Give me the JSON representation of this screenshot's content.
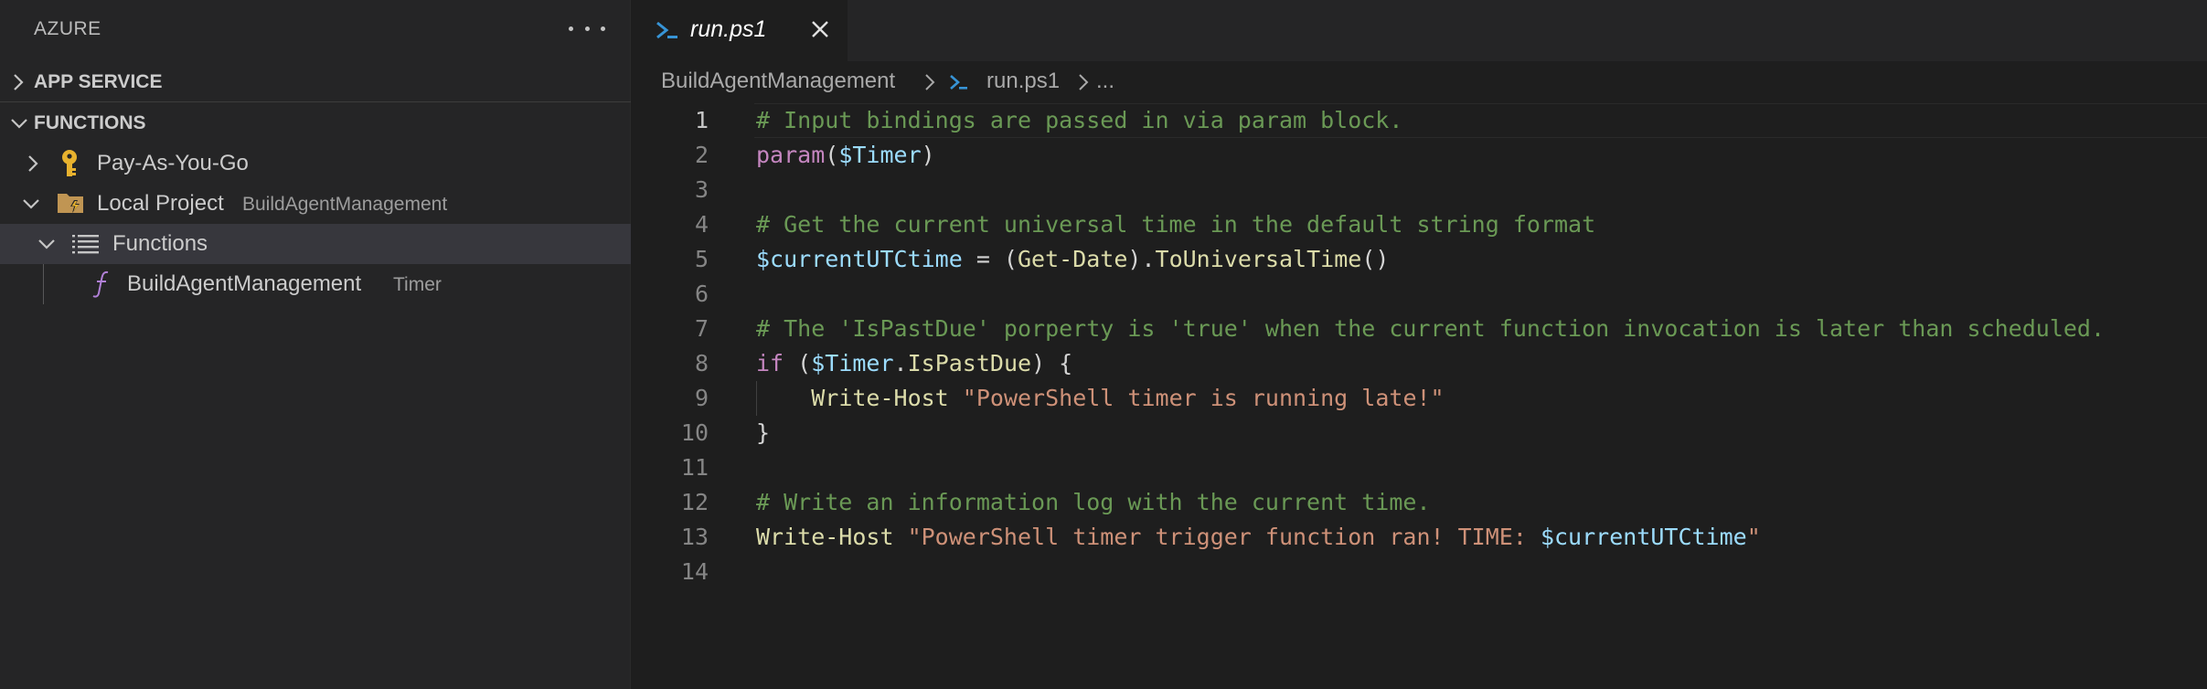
{
  "sidebar": {
    "title": "AZURE",
    "more_icon": "ellipsis-icon",
    "sections": {
      "app_service": "APP SERVICE",
      "functions": "FUNCTIONS"
    },
    "tree": {
      "subscription": "Pay-As-You-Go",
      "local_project": {
        "label": "Local Project",
        "description": "BuildAgentManagement"
      },
      "functions_node": "Functions",
      "function_item": {
        "label": "BuildAgentManagement",
        "description": "Timer"
      }
    }
  },
  "editor": {
    "tab": {
      "label": "run.ps1",
      "icon": "powershell-icon"
    },
    "breadcrumb": {
      "folder": "BuildAgentManagement",
      "file": "run.ps1",
      "more": "..."
    },
    "current_line": 1,
    "lines": [
      {
        "number": "1",
        "tokens": [
          {
            "t": "# Input bindings are passed in via param block.",
            "c": "cm"
          }
        ]
      },
      {
        "number": "2",
        "tokens": [
          {
            "t": "param",
            "c": "kw"
          },
          {
            "t": "(",
            "c": "pl"
          },
          {
            "t": "$Timer",
            "c": "var"
          },
          {
            "t": ")",
            "c": "pl"
          }
        ]
      },
      {
        "number": "3",
        "tokens": []
      },
      {
        "number": "4",
        "tokens": [
          {
            "t": "# Get the current universal time in the default string format",
            "c": "cm"
          }
        ]
      },
      {
        "number": "5",
        "tokens": [
          {
            "t": "$currentUTCtime",
            "c": "var"
          },
          {
            "t": " = (",
            "c": "pl"
          },
          {
            "t": "Get-Date",
            "c": "fn"
          },
          {
            "t": ").",
            "c": "pl"
          },
          {
            "t": "ToUniversalTime",
            "c": "fn"
          },
          {
            "t": "()",
            "c": "pl"
          }
        ]
      },
      {
        "number": "6",
        "tokens": []
      },
      {
        "number": "7",
        "tokens": [
          {
            "t": "# The 'IsPastDue' porperty is 'true' when the current function invocation is later than scheduled.",
            "c": "cm"
          }
        ]
      },
      {
        "number": "8",
        "tokens": [
          {
            "t": "if",
            "c": "kw"
          },
          {
            "t": " (",
            "c": "pl"
          },
          {
            "t": "$Timer",
            "c": "var"
          },
          {
            "t": ".",
            "c": "pl"
          },
          {
            "t": "IsPastDue",
            "c": "fn"
          },
          {
            "t": ") {",
            "c": "pl"
          }
        ]
      },
      {
        "number": "9",
        "guide": true,
        "tokens": [
          {
            "t": "    ",
            "c": "pl"
          },
          {
            "t": "Write-Host",
            "c": "fn"
          },
          {
            "t": " ",
            "c": "pl"
          },
          {
            "t": "\"PowerShell timer is running late!\"",
            "c": "str"
          }
        ]
      },
      {
        "number": "10",
        "tokens": [
          {
            "t": "}",
            "c": "pl"
          }
        ]
      },
      {
        "number": "11",
        "tokens": []
      },
      {
        "number": "12",
        "tokens": [
          {
            "t": "# Write an information log with the current time.",
            "c": "cm"
          }
        ]
      },
      {
        "number": "13",
        "tokens": [
          {
            "t": "Write-Host",
            "c": "fn"
          },
          {
            "t": " ",
            "c": "pl"
          },
          {
            "t": "\"PowerShell timer trigger function ran! TIME: ",
            "c": "str"
          },
          {
            "t": "$currentUTCtime",
            "c": "var"
          },
          {
            "t": "\"",
            "c": "str"
          }
        ]
      },
      {
        "number": "14",
        "tokens": []
      }
    ]
  },
  "colors": {
    "comment": "#6a9955",
    "keyword": "#c586c0",
    "variable": "#9cdcfe",
    "function": "#dcdcaa",
    "string": "#ce9178",
    "selection": "#37373d",
    "key_icon": "#e8b22e",
    "folder_icon": "#c09553",
    "function_icon": "#b180d7"
  }
}
